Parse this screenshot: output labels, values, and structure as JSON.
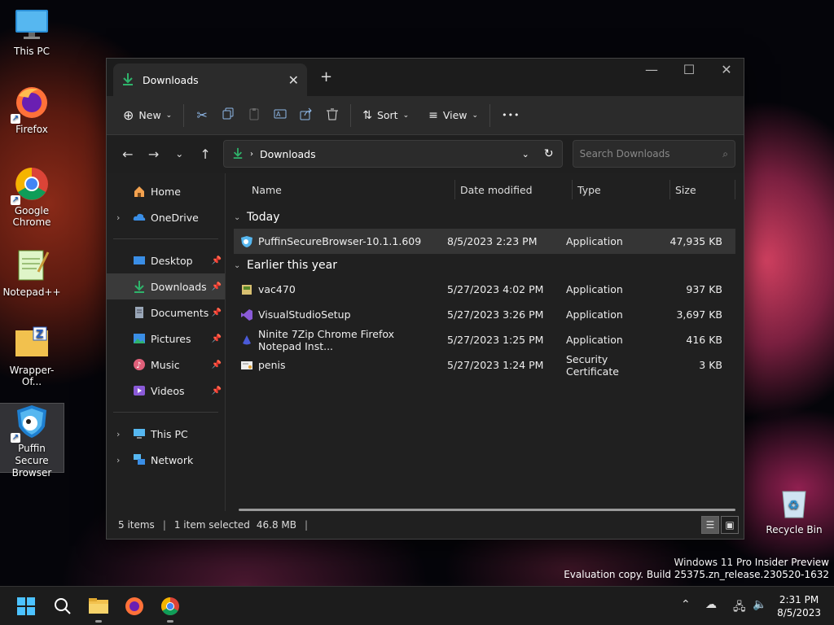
{
  "desktop": {
    "icons": [
      {
        "label": "This PC"
      },
      {
        "label": "Firefox"
      },
      {
        "label": "Google Chrome"
      },
      {
        "label": "Notepad++"
      },
      {
        "label": "Wrapper-Of..."
      },
      {
        "label": "Puffin Secure Browser"
      }
    ],
    "recycle_bin": "Recycle Bin",
    "watermark_line1": "Windows 11 Pro Insider Preview",
    "watermark_line2": "Evaluation copy. Build 25375.zn_release.230520-1632"
  },
  "window": {
    "tab_title": "Downloads",
    "new_tab_symbol": "+",
    "toolbar": {
      "new_label": "New",
      "sort_label": "Sort",
      "view_label": "View",
      "more_label": "•••"
    },
    "address": {
      "path": "Downloads",
      "search_placeholder": "Search Downloads"
    },
    "sidebar": {
      "quick": [
        {
          "label": "Home"
        },
        {
          "label": "OneDrive"
        }
      ],
      "pinned": [
        {
          "label": "Desktop"
        },
        {
          "label": "Downloads"
        },
        {
          "label": "Documents"
        },
        {
          "label": "Pictures"
        },
        {
          "label": "Music"
        },
        {
          "label": "Videos"
        }
      ],
      "locations": [
        {
          "label": "This PC"
        },
        {
          "label": "Network"
        }
      ]
    },
    "columns": {
      "name": "Name",
      "date": "Date modified",
      "type": "Type",
      "size": "Size"
    },
    "groups": [
      {
        "title": "Today",
        "files": [
          {
            "name": "PuffinSecureBrowser-10.1.1.609",
            "date": "8/5/2023 2:23 PM",
            "type": "Application",
            "size": "47,935 KB"
          }
        ]
      },
      {
        "title": "Earlier this year",
        "files": [
          {
            "name": "vac470",
            "date": "5/27/2023 4:02 PM",
            "type": "Application",
            "size": "937 KB"
          },
          {
            "name": "VisualStudioSetup",
            "date": "5/27/2023 3:26 PM",
            "type": "Application",
            "size": "3,697 KB"
          },
          {
            "name": "Ninite 7Zip Chrome Firefox Notepad Inst...",
            "date": "5/27/2023 1:25 PM",
            "type": "Application",
            "size": "416 KB"
          },
          {
            "name": "penis",
            "date": "5/27/2023 1:24 PM",
            "type": "Security Certificate",
            "size": "3 KB"
          }
        ]
      }
    ],
    "status": {
      "items": "5 items",
      "selected": "1 item selected",
      "size": "46.8 MB"
    }
  },
  "taskbar": {
    "time": "2:31 PM",
    "date": "8/5/2023"
  },
  "colors": {
    "accent_green": "#2fb36b",
    "folder_yellow": "#f2c14e",
    "window_bg": "#202020"
  }
}
